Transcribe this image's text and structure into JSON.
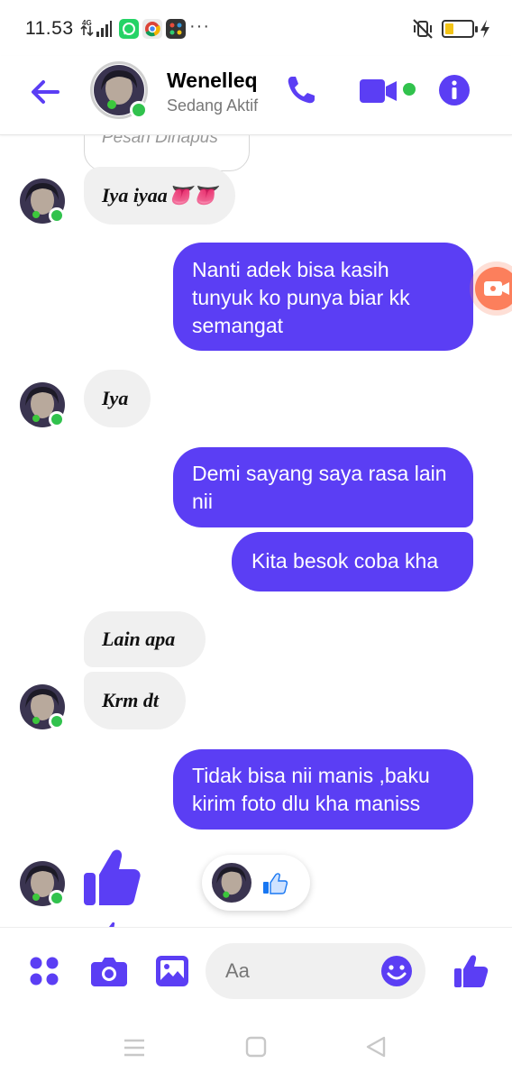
{
  "status_bar": {
    "time": "11.53",
    "network": "4G",
    "more": "···"
  },
  "colors": {
    "accent": "#5b3ef4",
    "online": "#31c24d",
    "incoming_bubble": "#f0f0f0",
    "video_bubble": "#fc7f5c"
  },
  "header": {
    "contact_name": "Wenelleq",
    "contact_status": "Sedang Aktif",
    "icons": [
      "back-arrow-icon",
      "phone-icon",
      "video-camera-icon",
      "info-icon"
    ]
  },
  "conversation": {
    "deleted_label": "Pesan Dihapus",
    "messages": [
      {
        "from": "them",
        "text": "Iya iyaa👅👅"
      },
      {
        "from": "me",
        "text": "Nanti adek bisa kasih tunyuk ko punya biar kk semangat"
      },
      {
        "from": "them",
        "text": "Iya"
      },
      {
        "from": "me",
        "text": "Demi sayang saya rasa lain nii"
      },
      {
        "from": "me",
        "text": "Kita besok coba kha"
      },
      {
        "from": "them",
        "text": "Lain apa"
      },
      {
        "from": "them",
        "text": "Krm dt"
      },
      {
        "from": "me",
        "text": "Tidak bisa nii manis ,baku kirim foto dlu kha maniss"
      },
      {
        "from": "them",
        "type": "like",
        "icon": "thumbs-up-icon"
      }
    ]
  },
  "composer": {
    "placeholder": "Aa",
    "icons": [
      "menu-dots-icon",
      "camera-icon",
      "gallery-icon",
      "emoji-icon",
      "like-icon"
    ]
  }
}
